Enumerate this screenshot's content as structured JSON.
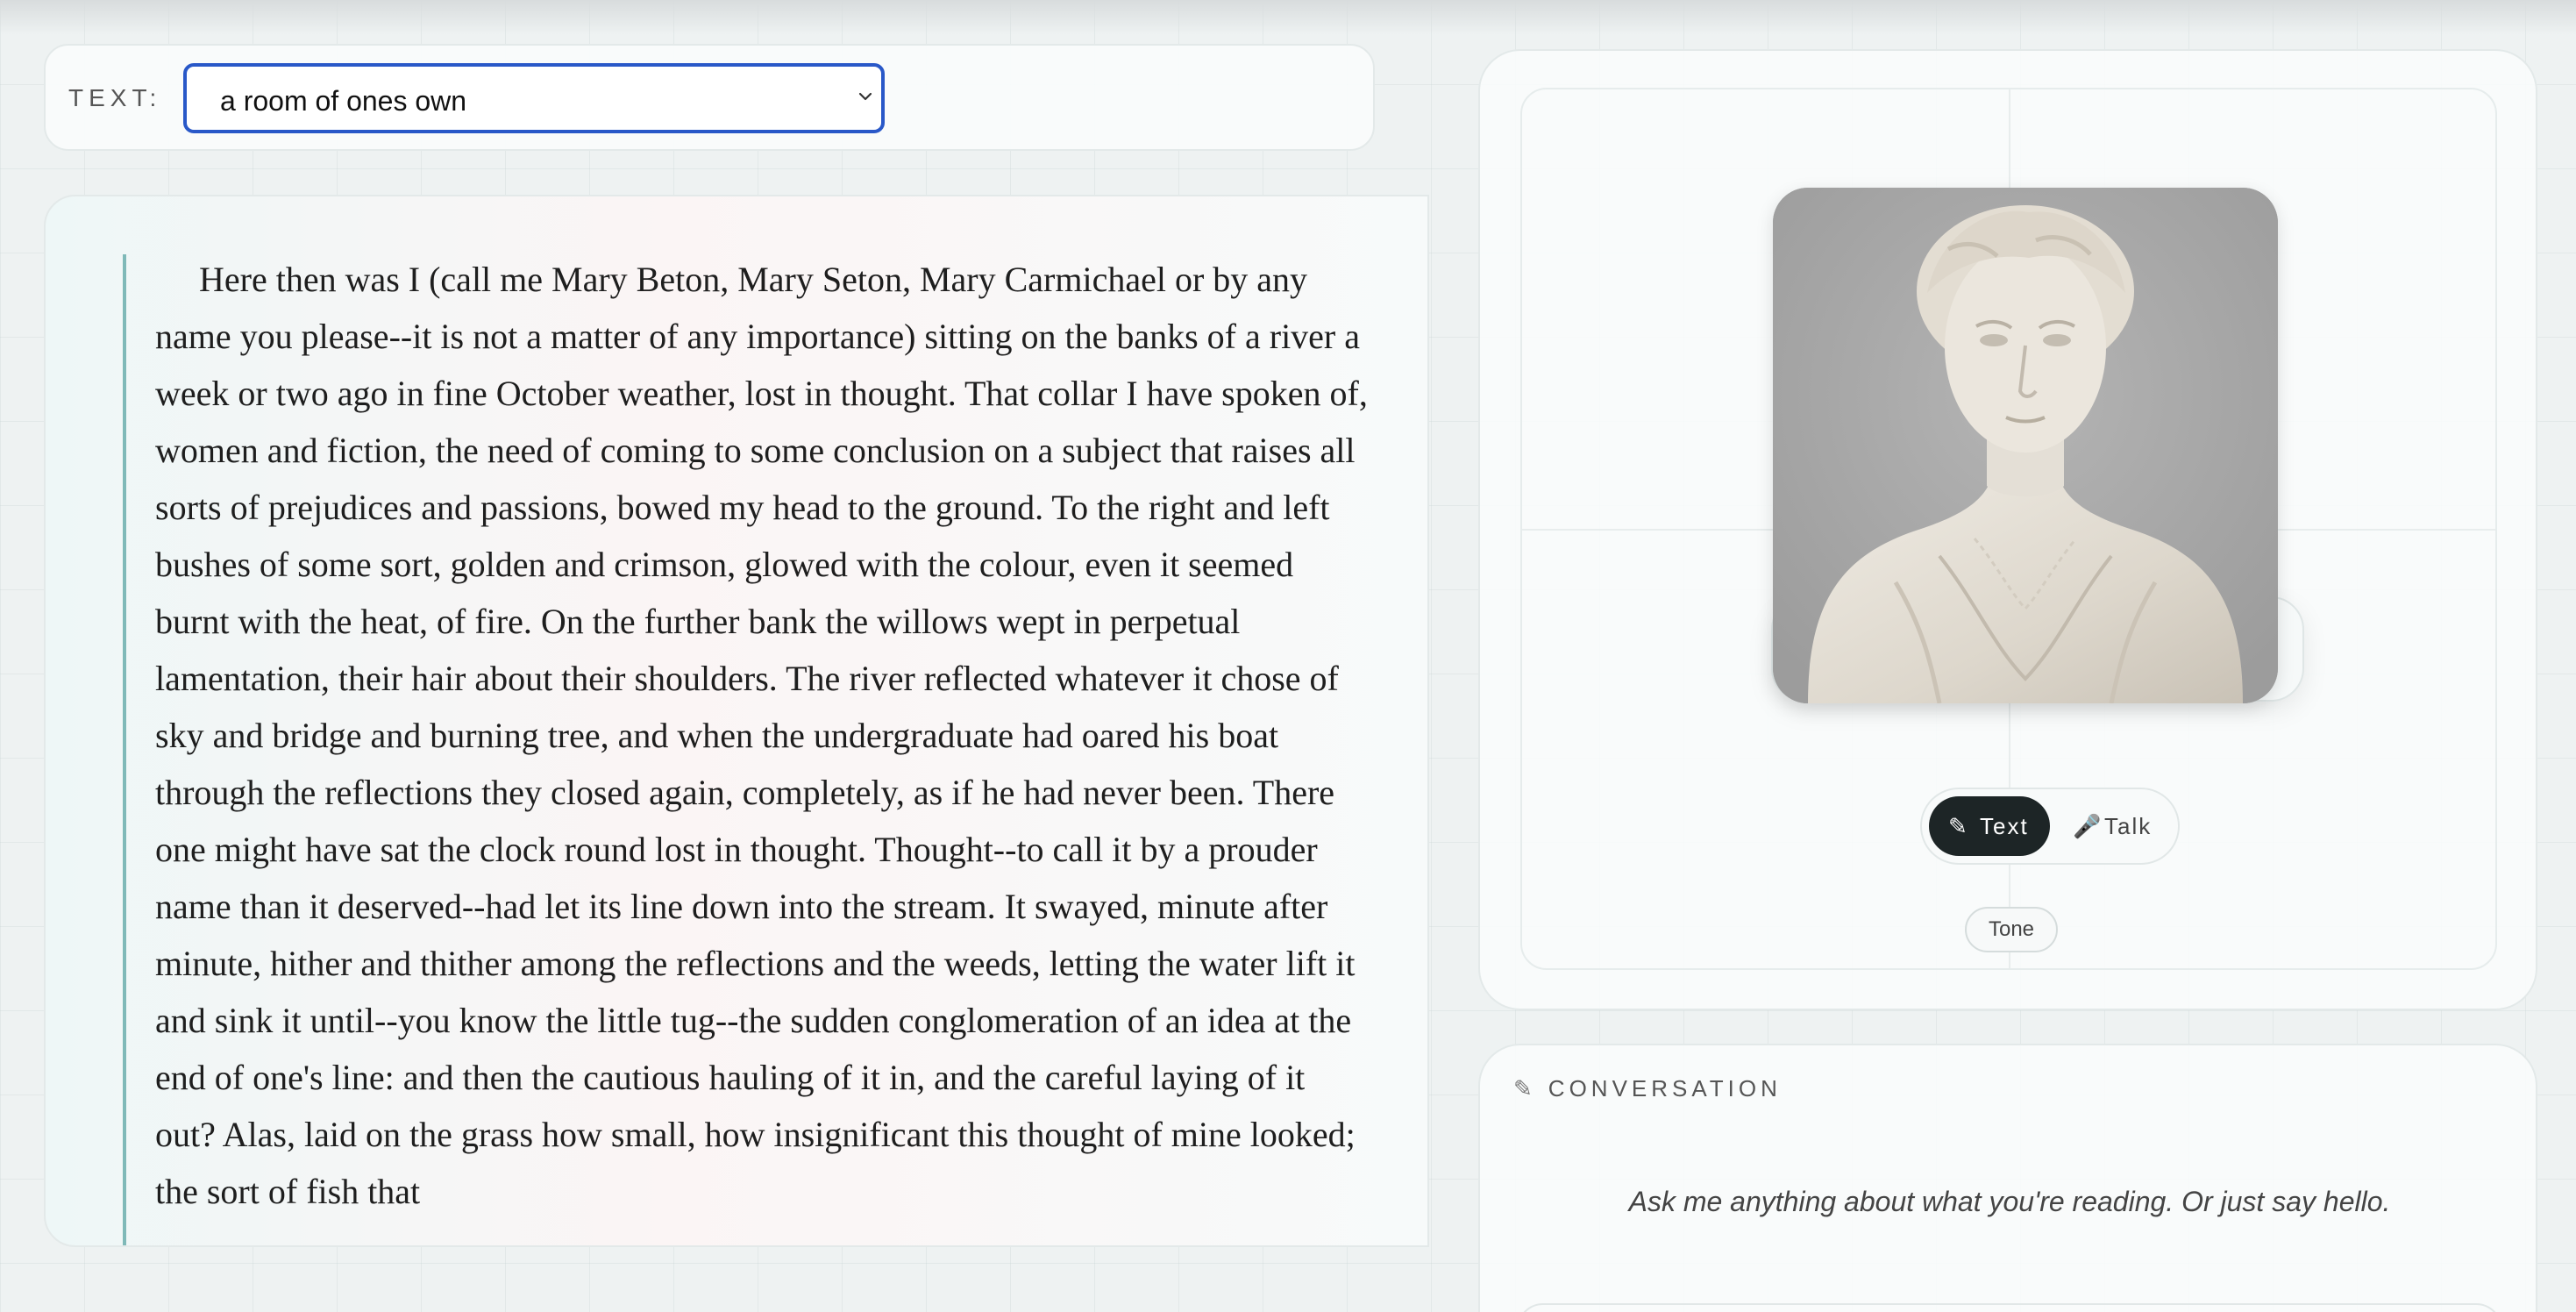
{
  "selector": {
    "label": "TEXT:",
    "selected": "a room of ones own"
  },
  "reading": {
    "passage": "Here then was I (call me Mary Beton, Mary Seton, Mary Carmichael or by any name you please--it is not a matter of any importance) sitting on the banks of a river a week or two ago in fine October weather, lost in thought. That collar I have spoken of, women and fiction, the need of coming to some conclusion on a subject that raises all sorts of prejudices and passions, bowed my head to the ground. To the right and left bushes of some sort, golden and crimson, glowed with the colour, even it seemed burnt with the heat, of fire. On the further bank the willows wept in perpetual lamentation, their hair about their shoulders. The river reflected whatever it chose of sky and bridge and burning tree, and when the undergraduate had oared his boat through the reflections they closed again, completely, as if he had never been. There one might have sat the clock round lost in thought. Thought--to call it by a prouder name than it deserved--had let its line down into the stream. It swayed, minute after minute, hither and thither among the reflections and the weeds, letting the water lift it and sink it until--you know the little tug--the sudden conglomeration of an idea at the end of one's line: and then the cautious hauling of it in, and the careful laying of it out? Alas, laid on the grass how small, how insignificant this thought of mine looked; the sort of fish that"
  },
  "avatar": {
    "modes": {
      "text_label": "Text",
      "text_icon": "pencil-icon",
      "talk_label": "Talk",
      "talk_icon": "microphone-icon",
      "active": "text"
    },
    "tone_label": "Tone",
    "accent_bar_color": "#f0a6b8"
  },
  "conversation": {
    "header": "CONVERSATION",
    "header_icon": "pencil-icon",
    "hint": "Ask me anything about what you're reading. Or just say hello."
  }
}
